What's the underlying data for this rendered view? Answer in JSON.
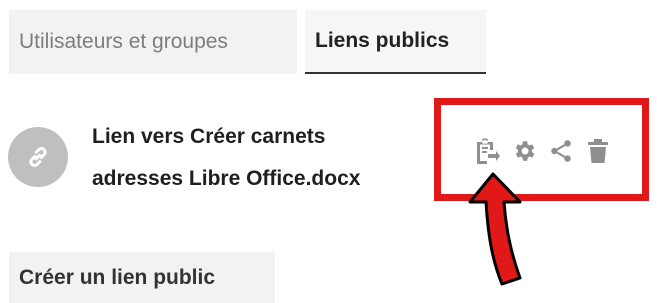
{
  "tabs": {
    "users_groups": "Utilisateurs et groupes",
    "public_links": "Liens publics"
  },
  "link": {
    "name_line1": "Lien vers Créer carnets",
    "name_line2": "adresses Libre Office.docx"
  },
  "icons": {
    "link": "link-icon",
    "copy": "clipboard-icon",
    "settings": "gear-icon",
    "share": "share-icon",
    "delete": "trash-icon"
  },
  "annotation": {
    "highlight_color": "#e01818"
  },
  "actions": {
    "create_public_link": "Créer un lien public"
  }
}
